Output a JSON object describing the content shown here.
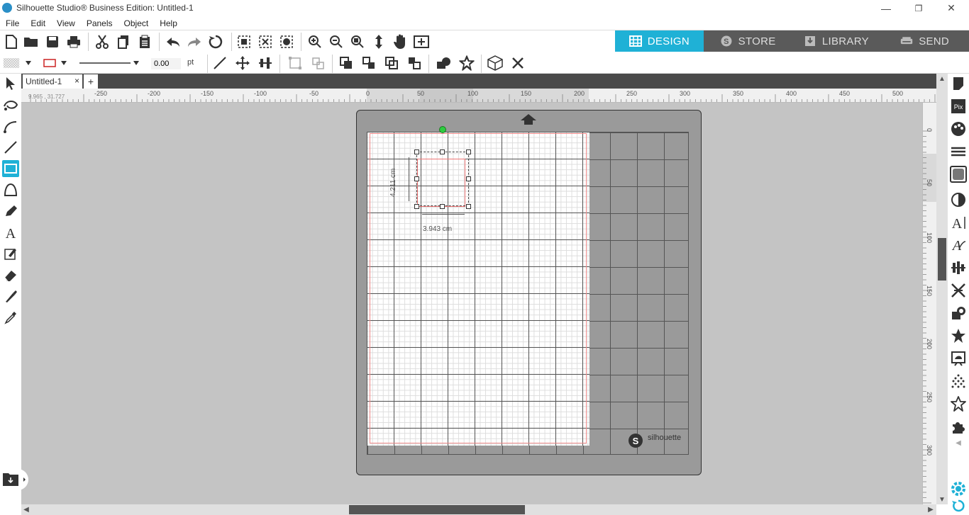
{
  "window": {
    "title": "Silhouette Studio® Business Edition: Untitled-1",
    "minimize": "—",
    "restore": "❐",
    "close": "✕"
  },
  "menu": [
    "File",
    "Edit",
    "View",
    "Panels",
    "Object",
    "Help"
  ],
  "mode_tabs": [
    {
      "label": "DESIGN",
      "active": true
    },
    {
      "label": "STORE",
      "active": false
    },
    {
      "label": "LIBRARY",
      "active": false
    },
    {
      "label": "SEND",
      "active": false
    }
  ],
  "line_style": {
    "width_value": "0.00",
    "unit": "pt"
  },
  "document_tab": {
    "label": "Untitled-1",
    "close": "×",
    "add": "+"
  },
  "coordinates": "9.965 , 31.727",
  "horizontal_ruler": [
    "-250",
    "-200",
    "-150",
    "-100",
    "-50",
    "0",
    "50",
    "100",
    "150",
    "200",
    "250",
    "300",
    "350",
    "400",
    "450",
    "500"
  ],
  "vertical_ruler": [
    "0",
    "50",
    "100",
    "150",
    "200",
    "250",
    "300"
  ],
  "selection": {
    "height_label": "4.211 cm",
    "width_label": "3.943 cm"
  },
  "mat": {
    "logo_letter": "S",
    "brand": "silhouette"
  },
  "colors": {
    "accent": "#1fb1d6",
    "mode_bar": "#5a5a5a",
    "canvas": "#c4c4c4",
    "mat": "#9a9a9a",
    "cut_line": "#e88888",
    "rotate_handle": "#2ecc40"
  }
}
